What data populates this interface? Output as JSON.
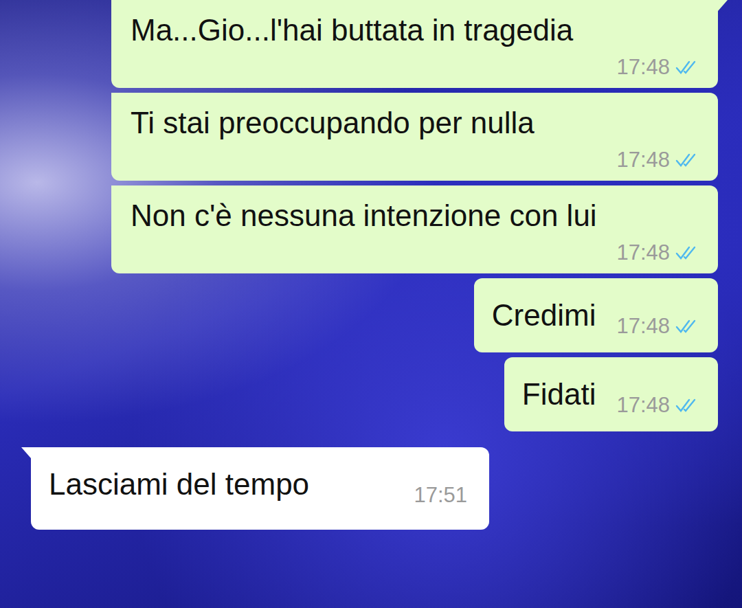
{
  "messages": [
    {
      "text": "Ma...Gio...l'hai buttata in tragedia",
      "time": "17:48",
      "direction": "outgoing",
      "kind": "stacked",
      "read": true,
      "tail": true
    },
    {
      "text": "Ti stai preoccupando per nulla",
      "time": "17:48",
      "direction": "outgoing",
      "kind": "stacked",
      "read": true,
      "tail": false
    },
    {
      "text": "Non c'è nessuna intenzione con lui",
      "time": "17:48",
      "direction": "outgoing",
      "kind": "stacked",
      "read": true,
      "tail": false
    },
    {
      "text": "Credimi",
      "time": "17:48",
      "direction": "outgoing",
      "kind": "inline",
      "read": true,
      "tail": false
    },
    {
      "text": "Fidati",
      "time": "17:48",
      "direction": "outgoing",
      "kind": "inline",
      "read": true,
      "tail": false
    },
    {
      "text": "Lasciami del tempo",
      "time": "17:51",
      "direction": "incoming",
      "kind": "inline",
      "read": false,
      "tail": true
    }
  ]
}
